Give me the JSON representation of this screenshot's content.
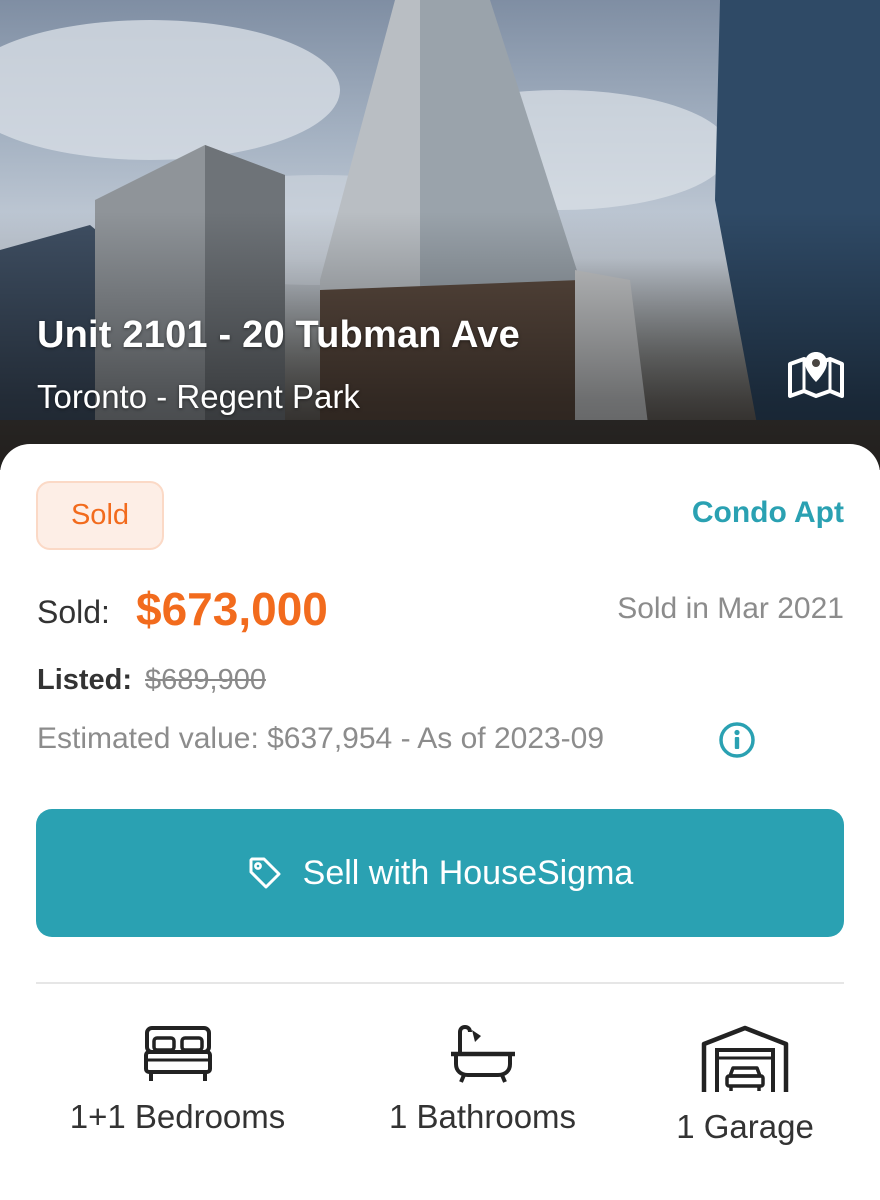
{
  "hero": {
    "title": "Unit 2101 - 20 Tubman Ave",
    "subtitle": "Toronto - Regent Park",
    "map_icon": "map-pin-icon"
  },
  "listing": {
    "status_badge": "Sold",
    "property_type": "Condo Apt",
    "sold_label": "Sold:",
    "sold_price": "$673,000",
    "sold_date": "Sold in Mar 2021",
    "listed_label": "Listed:",
    "listed_price": "$689,900",
    "estimate": "Estimated value: $637,954 - As of 2023-09",
    "info_icon": "info-icon"
  },
  "cta": {
    "label": "Sell with HouseSigma",
    "icon": "tag-icon"
  },
  "features": [
    {
      "icon": "bed-icon",
      "label": "1+1 Bedrooms"
    },
    {
      "icon": "bathtub-icon",
      "label": "1 Bathrooms"
    },
    {
      "icon": "garage-icon",
      "label": "1 Garage"
    }
  ],
  "colors": {
    "accent": "#2aa1b2",
    "sold_orange": "#f26b1d",
    "badge_bg": "#fdeee6",
    "muted_text": "#8c8c8c"
  }
}
